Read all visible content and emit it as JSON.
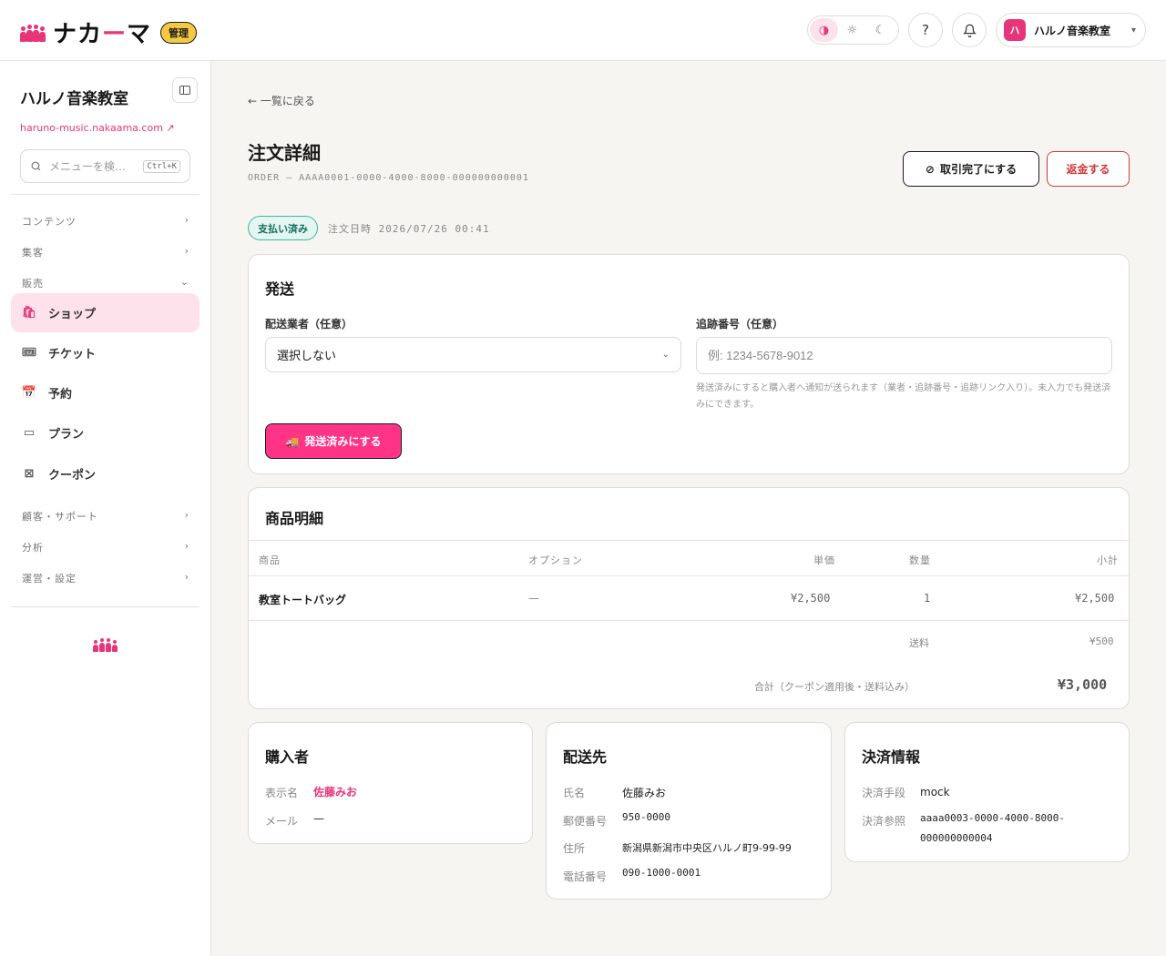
{
  "header": {
    "logo_text_a": "ナカ",
    "logo_text_b": "ー",
    "logo_text_c": "マ",
    "admin_badge": "管理",
    "theme_options": [
      "contrast",
      "light",
      "dark"
    ],
    "org_avatar": "ハ",
    "org_name": "ハルノ音楽教室"
  },
  "sidebar": {
    "title": "ハルノ音楽教室",
    "url": "haruno-music.nakaama.com",
    "search_placeholder": "メニューを検…",
    "search_shortcut": "Ctrl+K",
    "groups": {
      "content": "コンテンツ",
      "marketing": "集客",
      "sales": "販売",
      "customers": "顧客・サポート",
      "analytics": "分析",
      "operations": "運営・設定"
    },
    "items": [
      {
        "label": "ショップ",
        "icon": "shopping-bag-icon"
      },
      {
        "label": "チケット",
        "icon": "ticket-icon"
      },
      {
        "label": "予約",
        "icon": "calendar-icon"
      },
      {
        "label": "プラン",
        "icon": "credit-card-icon"
      },
      {
        "label": "クーポン",
        "icon": "coupon-icon"
      }
    ]
  },
  "page": {
    "back_label": "一覧に戻る",
    "title": "注文詳細",
    "order_id": "ORDER — AAAA0001-0000-4000-8000-000000000001",
    "complete_button": "取引完了にする",
    "refund_button": "返金する",
    "status": "支払い済み",
    "order_date_label": "注文日時",
    "order_date": "2026/07/26 00:41"
  },
  "shipping": {
    "title": "発送",
    "carrier_label": "配送業者（任意）",
    "carrier_value": "選択しない",
    "tracking_label": "追跡番号（任意）",
    "tracking_placeholder": "例: 1234-5678-9012",
    "help_text": "発送済みにすると購入者へ通知が送られます（業者・追跡番号・追跡リンク入り）。未入力でも発送済みにできます。",
    "ship_button": "発送済みにする"
  },
  "items": {
    "title": "商品明細",
    "columns": {
      "product": "商品",
      "option": "オプション",
      "price": "単価",
      "qty": "数量",
      "subtotal": "小計"
    },
    "rows": [
      {
        "product": "教室トートバッグ",
        "option": "—",
        "price": "¥2,500",
        "qty": "1",
        "subtotal": "¥2,500"
      }
    ],
    "shipping_label": "送料",
    "shipping_value": "¥500",
    "total_label": "合計（クーポン適用後・送料込み）",
    "total_value": "¥3,000"
  },
  "buyer": {
    "title": "購入者",
    "name_label": "表示名",
    "name_value": "佐藤みお",
    "email_label": "メール",
    "email_value": "—"
  },
  "destination": {
    "title": "配送先",
    "name_label": "氏名",
    "name_value": "佐藤みお",
    "zip_label": "郵便番号",
    "zip_value": "950-0000",
    "address_label": "住所",
    "address_value": "新潟県新潟市中央区ハルノ町9-99-99",
    "phone_label": "電話番号",
    "phone_value": "090-1000-0001"
  },
  "payment": {
    "title": "決済情報",
    "method_label": "決済手段",
    "method_value": "mock",
    "ref_label": "決済参照",
    "ref_value_1": "aaaa0003-0000-4000-8000-",
    "ref_value_2": "000000000004"
  },
  "colors": {
    "brand": "#e8357a",
    "accent_button": "#ff3486",
    "danger": "#d03a3a",
    "status": "#3fb7a0"
  }
}
